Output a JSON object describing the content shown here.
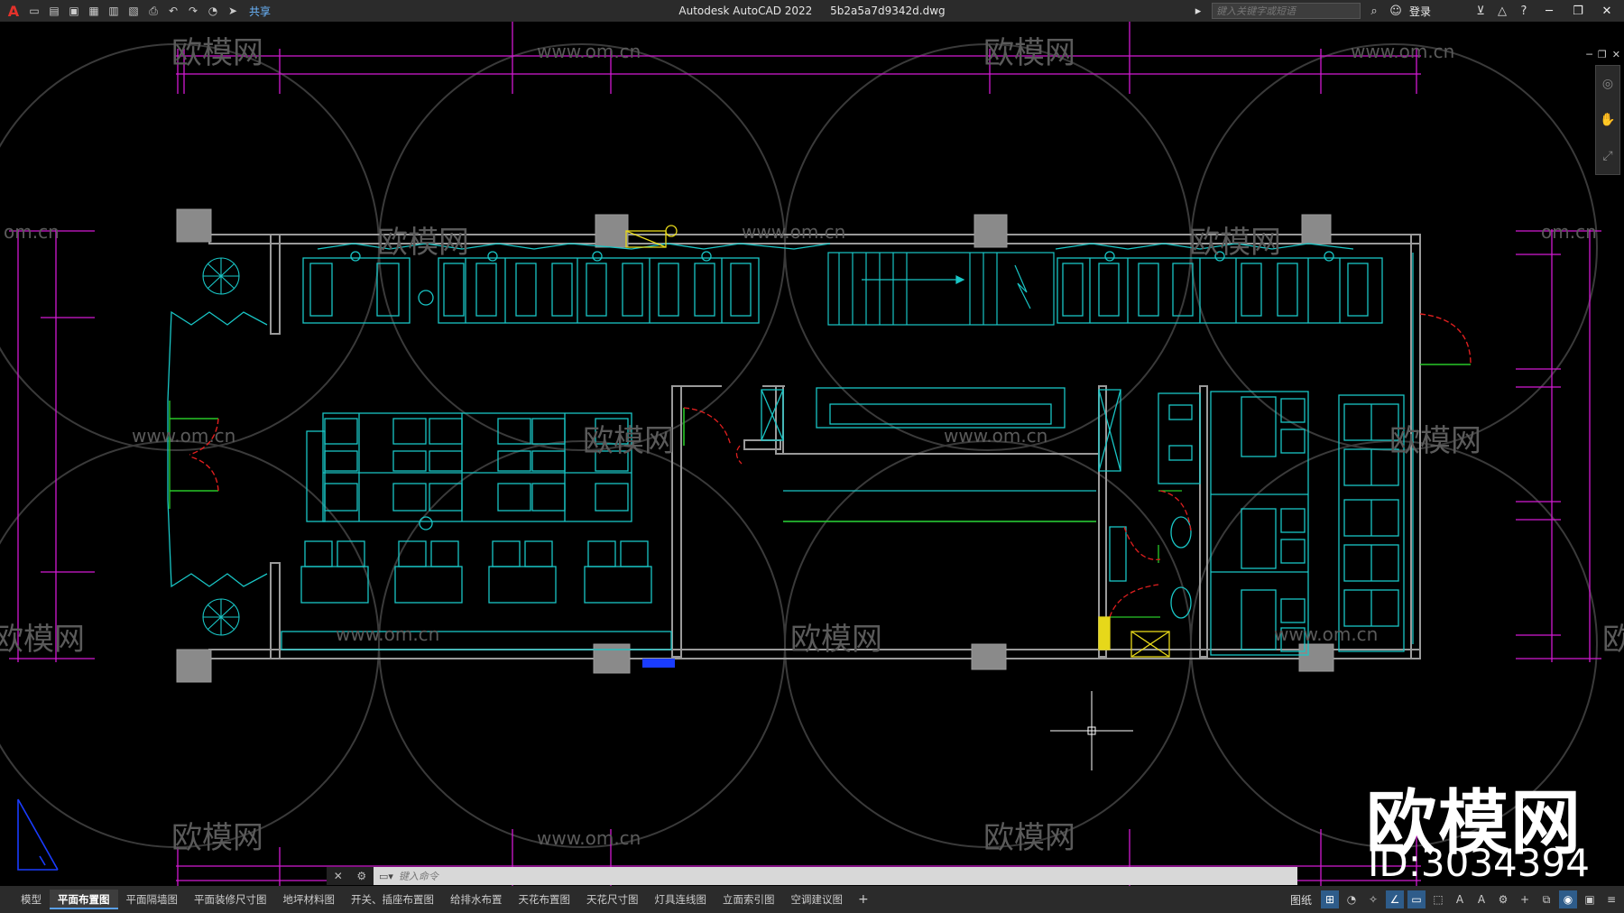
{
  "titlebar": {
    "app_name": "Autodesk AutoCAD 2022",
    "file_name": "5b2a5a7d9342d.dwg",
    "share_label": "共享",
    "search_placeholder": "键入关键字或短语",
    "login_label": "登录"
  },
  "watermark": {
    "site": "www.om.cn",
    "brand": "欧模网",
    "side_text": "om.cn",
    "big_brand": "欧模网",
    "id_text": "ID:3034394"
  },
  "command": {
    "placeholder": "键入命令"
  },
  "layout_tabs": [
    {
      "label": "模型",
      "active": false
    },
    {
      "label": "平面布置图",
      "active": true
    },
    {
      "label": "平面隔墙图",
      "active": false
    },
    {
      "label": "平面装修尺寸图",
      "active": false
    },
    {
      "label": "地坪材料图",
      "active": false
    },
    {
      "label": "开关、插座布置图",
      "active": false
    },
    {
      "label": "给排水布置",
      "active": false
    },
    {
      "label": "天花布置图",
      "active": false
    },
    {
      "label": "天花尺寸图",
      "active": false
    },
    {
      "label": "灯具连线图",
      "active": false
    },
    {
      "label": "立面索引图",
      "active": false
    },
    {
      "label": "空调建议图",
      "active": false
    }
  ],
  "status": {
    "paper_label": "图纸"
  },
  "colors": {
    "wall": "#9a9a9a",
    "furniture": "#19c6c6",
    "dimension": "#d21ad2",
    "door_swing": "#e01f1f",
    "door_leaf": "#28c828",
    "accent_yellow": "#e6d81a",
    "circle_grid": "#3c3c3c"
  },
  "icons": {
    "app": "autocad-logo-icon",
    "crosshair": "crosshair-icon",
    "ucs": "ucs-icon"
  }
}
